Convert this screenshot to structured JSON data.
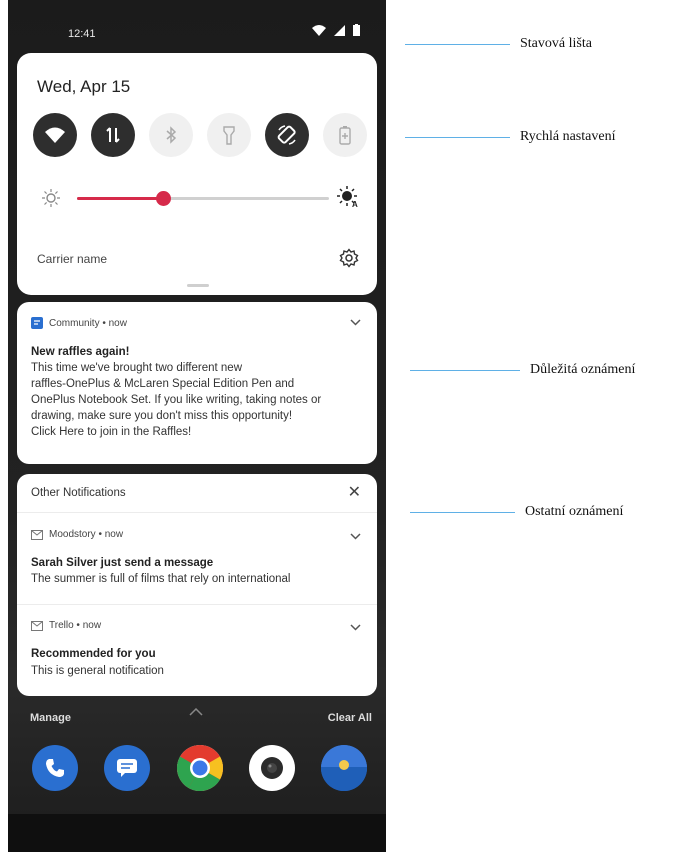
{
  "status_bar": {
    "time": "12:41"
  },
  "quick_settings": {
    "date": "Wed, Apr 15",
    "tiles": [
      {
        "name": "wifi-tile",
        "state": "on"
      },
      {
        "name": "mobile-data-tile",
        "state": "on"
      },
      {
        "name": "bluetooth-tile",
        "state": "off"
      },
      {
        "name": "flashlight-tile",
        "state": "off"
      },
      {
        "name": "auto-rotate-tile",
        "state": "on"
      },
      {
        "name": "battery-saver-tile",
        "state": "off"
      }
    ],
    "brightness_level": 0.34,
    "carrier": "Carrier name"
  },
  "important_notification": {
    "app": "Community • now",
    "title": "New raffles again!",
    "lines": [
      "This time we've brought two different new",
      "raffles-OnePlus & McLaren Special Edition Pen and",
      "OnePlus Notebook Set. If you like writing, taking notes or",
      "drawing, make sure you don't miss this opportunity!",
      "Click Here to join in the Raffles!"
    ]
  },
  "other_notifications": {
    "header": "Other Notifications",
    "items": [
      {
        "app": "Moodstory • now",
        "title": "Sarah Silver just send a message",
        "body": "The summer is full of films that rely on international"
      },
      {
        "app": "Trello • now",
        "title": "Recommended for you",
        "body": "This is general notification"
      }
    ]
  },
  "footer": {
    "manage": "Manage",
    "clear_all": "Clear All"
  },
  "callouts": {
    "status_bar": "Stavová lišta",
    "quick_settings": "Rychlá nastavení",
    "important": "Důležitá oznámení",
    "other": "Ostatní oznámení"
  },
  "colors": {
    "accent": "#d62a4a",
    "callout_line": "#5fb0e6",
    "phone_accent_blue": "#2a6fd0"
  }
}
